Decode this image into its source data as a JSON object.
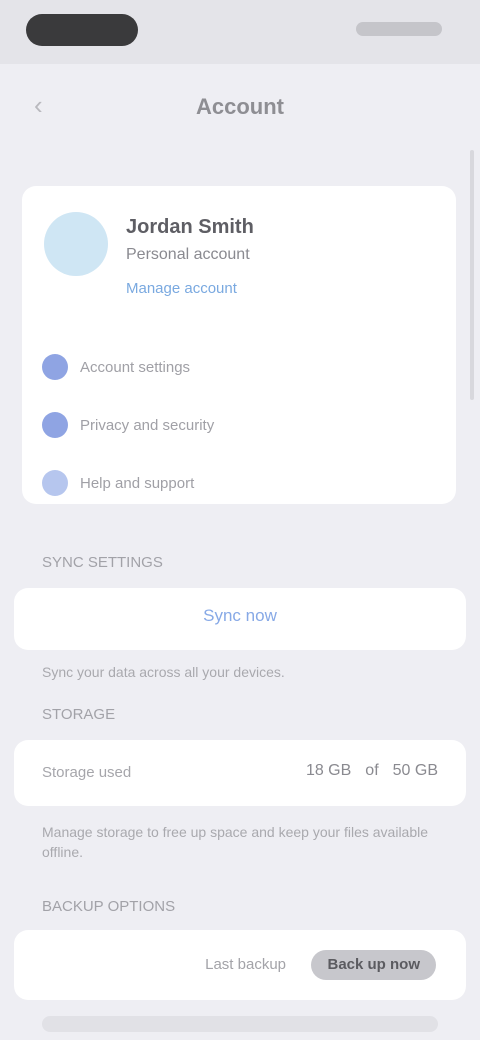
{
  "nav": {
    "title": "Account"
  },
  "profile": {
    "name": "Jordan Smith",
    "subtitle": "Personal account",
    "link": "Manage account"
  },
  "profile_items": [
    {
      "label": "Account settings"
    },
    {
      "label": "Privacy and security"
    },
    {
      "label": "Help and support"
    }
  ],
  "sections": {
    "sync_header": "SYNC SETTINGS",
    "sync_button": "Sync now",
    "sync_footer": "Sync your data across all your devices.",
    "storage_header": "STORAGE",
    "storage_label": "Storage used",
    "storage_value_a": "18 GB",
    "storage_value_b": "of",
    "storage_value_c": "50 GB",
    "storage_footer": "Manage storage to free up space and keep your files available offline.",
    "backup_header": "BACKUP OPTIONS",
    "backup_prefix": "Last backup",
    "backup_button": "Back up now"
  },
  "colors": {
    "background": "#eeeef3",
    "card": "#ffffff",
    "accent": "#87a9e6"
  }
}
